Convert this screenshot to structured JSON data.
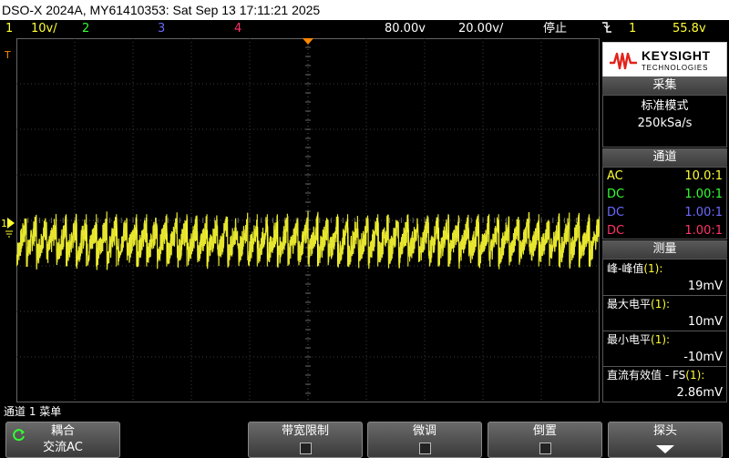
{
  "title": "DSO-X 2024A, MY61410353: Sat Sep 13 17:11:21 2025",
  "status": {
    "ch1_num": "1",
    "ch1_scale": "10ⅴ/",
    "ch2_num": "2",
    "ch3_num": "3",
    "ch4_num": "4",
    "timebase": "80.00ⅴ",
    "timescale": "20.00ⅴ/",
    "run_state": "停止",
    "trigger_icon": "trigger-edge-falling",
    "trigger_src": "1",
    "trigger_level": "55.8ⅴ"
  },
  "brand": {
    "name": "KEYSIGHT",
    "sub": "TECHNOLOGIES"
  },
  "acquisition": {
    "header": "采集",
    "mode": "标准模式",
    "rate": "250kSa/s"
  },
  "channels": {
    "header": "通道",
    "rows": [
      {
        "coupling": "AC",
        "probe": "10.0:1",
        "color": "#ffff33"
      },
      {
        "coupling": "DC",
        "probe": "1.00:1",
        "color": "#33ff33"
      },
      {
        "coupling": "DC",
        "probe": "1.00:1",
        "color": "#6a6aff"
      },
      {
        "coupling": "DC",
        "probe": "1.00:1",
        "color": "#ff3366"
      }
    ]
  },
  "measure": {
    "header": "测量",
    "items": [
      {
        "label": "峰-峰值",
        "src": "(1):",
        "value": "19mV"
      },
      {
        "label": "最大电平",
        "src": "(1):",
        "value": "10mV"
      },
      {
        "label": "最小电平",
        "src": "(1):",
        "value": "-10mV"
      },
      {
        "label": "直流有效值 - FS",
        "src": "(1):",
        "value": "2.86mV"
      }
    ]
  },
  "menu": {
    "title": "通道 1 菜单",
    "coupling_label": "耦合",
    "coupling_value": "交流AC",
    "bw_limit_label": "带宽限制",
    "fine_label": "微调",
    "invert_label": "倒置",
    "probe_label": "探头"
  },
  "colors": {
    "ch1": "#ffff33",
    "ch2": "#33ff33",
    "ch3": "#6a6aff",
    "ch4": "#ff3366",
    "grid": "#3a3a3a",
    "trigger_marker": "#ff8800"
  },
  "waveform": {
    "channel": "1",
    "offset_divs": 0.45,
    "amplitude_divs": 0.45,
    "cycles": 58
  }
}
